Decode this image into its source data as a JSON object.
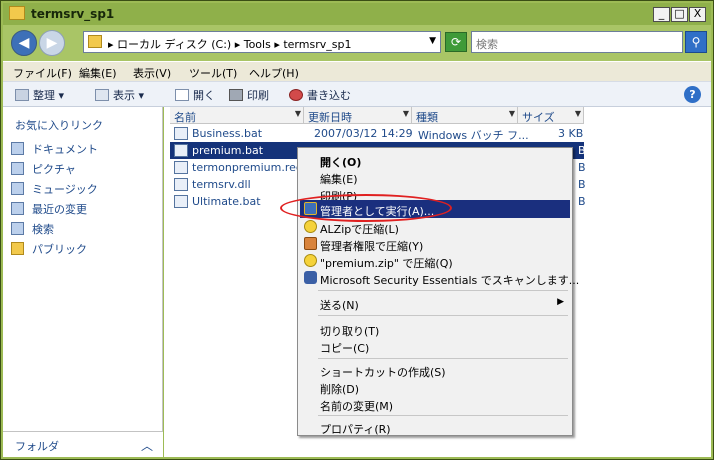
{
  "window": {
    "title": "termsrv_sp1",
    "buttons": [
      "_",
      "□",
      "X"
    ]
  },
  "address": {
    "path": "▸ ローカル ディスク (C:) ▸ Tools ▸ termsrv_sp1",
    "search_placeholder": "検索"
  },
  "menubar": [
    "ファイル(F)",
    "編集(E)",
    "表示(V)",
    "ツール(T)",
    "ヘルプ(H)"
  ],
  "toolbar": {
    "organize": "整理",
    "view": "表示",
    "open": "開く",
    "print": "印刷",
    "burn": "書き込む"
  },
  "nav": {
    "favorites": "お気に入りリンク",
    "items": [
      "ドキュメント",
      "ピクチャ",
      "ミュージック",
      "最近の変更",
      "検索",
      "パブリック"
    ],
    "folders": "フォルダ"
  },
  "columns": [
    "名前",
    "更新日時",
    "種類",
    "サイズ"
  ],
  "files": [
    {
      "name": "Business.bat",
      "date": "2007/03/12 14:29",
      "type": "Windows バッチ フ...",
      "size": "3 KB"
    },
    {
      "name": "premium.bat",
      "date": "",
      "type": "",
      "size": "B"
    },
    {
      "name": "termonpremium.reg",
      "date": "",
      "type": "",
      "size": "B"
    },
    {
      "name": "termsrv.dll",
      "date": "",
      "type": "",
      "size": "B"
    },
    {
      "name": "Ultimate.bat",
      "date": "",
      "type": "",
      "size": "B"
    }
  ],
  "context_menu": [
    "開く(O)",
    "編集(E)",
    "印刷(P)",
    "管理者として実行(A)...",
    "ALZipで圧縮(L)",
    "管理者権限で圧縮(Y)",
    "\"premium.zip\" で圧縮(Q)",
    "Microsoft Security Essentials でスキャンします...",
    "送る(N)",
    "切り取り(T)",
    "コピー(C)",
    "ショートカットの作成(S)",
    "削除(D)",
    "名前の変更(M)",
    "プロパティ(R)"
  ],
  "colors": {
    "highlight": "#1a2f7e",
    "oval": "#e02020",
    "chrome": "#9dbb55"
  }
}
